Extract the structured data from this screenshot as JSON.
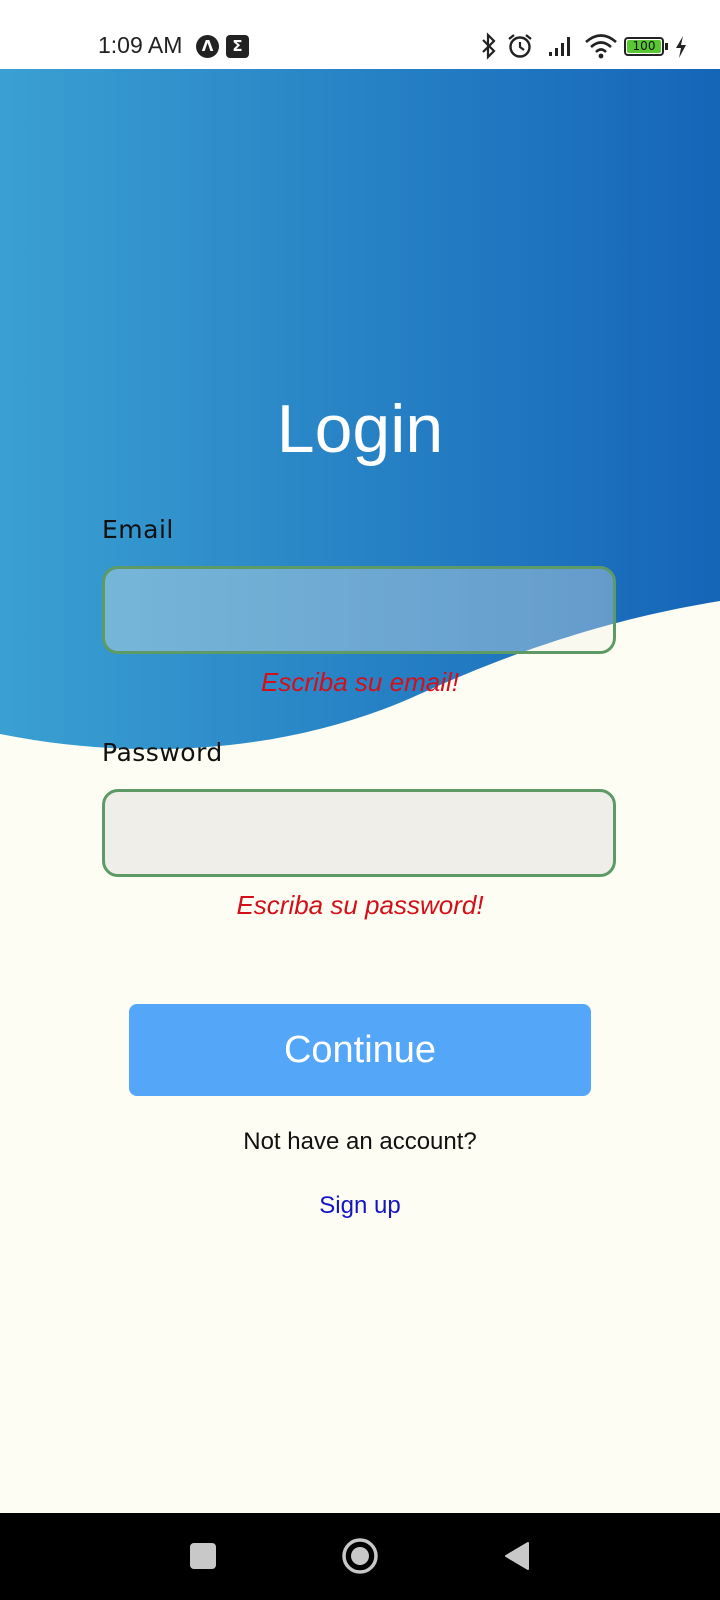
{
  "status_bar": {
    "time": "1:09 AM",
    "badge_1": "Λ",
    "badge_2": "Σ",
    "battery_level": "100",
    "icons": [
      "bluetooth-icon",
      "alarm-icon",
      "signal-icon",
      "wifi-icon",
      "battery-icon",
      "charging-icon"
    ]
  },
  "login": {
    "title": "Login",
    "email_label": "Email",
    "email_value": "",
    "email_error": "Escriba su email!",
    "password_label": "Password",
    "password_value": "",
    "password_error": "Escriba su password!",
    "continue_label": "Continue",
    "prompt": "Not have an account?",
    "signup_label": "Sign up"
  },
  "colors": {
    "gradient_start": "#3aa0d2",
    "gradient_end": "#1565b8",
    "background": "#fdfdf3",
    "input_border": "#5e9a66",
    "error": "#d3101a",
    "button": "#54a6f8",
    "link": "#1414c4"
  },
  "nav_bar": {
    "icons": [
      "recent-apps-icon",
      "home-icon",
      "back-icon"
    ]
  }
}
